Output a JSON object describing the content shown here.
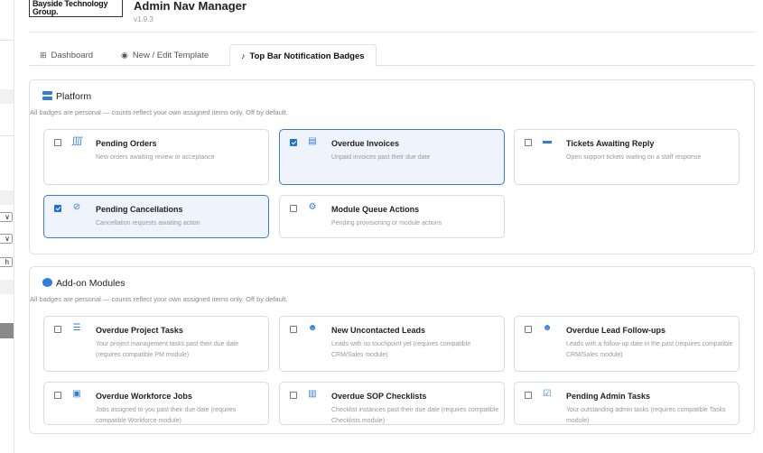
{
  "header": {
    "logo_line1": "Bayside Technology",
    "logo_line2": "Group.",
    "title": "Admin Nav Manager",
    "version": "v1.9.3"
  },
  "sidebar": {
    "select1_glyph": "∨",
    "select2_glyph": "∨",
    "button_glyph": "h"
  },
  "tabs": [
    {
      "label": "Dashboard",
      "icon": "grid-icon",
      "glyph": "⊞",
      "active": false
    },
    {
      "label": "New / Edit Template",
      "icon": "database-icon",
      "glyph": "◉",
      "active": false
    },
    {
      "label": "Top Bar Notification Badges",
      "icon": "bell-icon",
      "glyph": "♪",
      "active": true
    }
  ],
  "sections": [
    {
      "title": "Platform",
      "icon": "bars-icon",
      "description": "All badges are personal — counts reflect your own assigned items only. Off by default.",
      "cards": [
        {
          "title": "Pending Orders",
          "desc": "New orders awaiting review or acceptance",
          "icon": "cart-icon",
          "glyph": "⨌",
          "checked": false
        },
        {
          "title": "Overdue Invoices",
          "desc": "Unpaid invoices past their due date",
          "icon": "invoice-icon",
          "glyph": "▤",
          "checked": true
        },
        {
          "title": "Tickets Awaiting Reply",
          "desc": "Open support tickets waiting on a staff response",
          "icon": "ticket-icon",
          "glyph": "▬",
          "checked": false
        },
        {
          "title": "Pending Cancellations",
          "desc": "Cancellation requests awaiting action",
          "icon": "ban-icon",
          "glyph": "⊘",
          "checked": true
        },
        {
          "title": "Module Queue Actions",
          "desc": "Pending provisioning or module actions",
          "icon": "cogs-icon",
          "glyph": "⚙",
          "checked": false
        }
      ]
    },
    {
      "title": "Add-on Modules",
      "icon": "cube-icon",
      "description": "All badges are personal — counts reflect your own assigned items only. Off by default.",
      "cards": [
        {
          "title": "Overdue Project Tasks",
          "desc": "Your project management tasks past their due date (requires compatible PM module)",
          "icon": "task-list-icon",
          "glyph": "☰",
          "checked": false
        },
        {
          "title": "New Uncontacted Leads",
          "desc": "Leads with no touchpoint yet (requires compatible CRM/Sales module)",
          "icon": "user-plus-icon",
          "glyph": "☻",
          "checked": false
        },
        {
          "title": "Overdue Lead Follow-ups",
          "desc": "Leads with a follow-up date in the past (requires compatible CRM/Sales module)",
          "icon": "user-clock-icon",
          "glyph": "☻",
          "checked": false
        },
        {
          "title": "Overdue Workforce Jobs",
          "desc": "Jobs assigned to you past their due date (requires compatible Workforce module)",
          "icon": "briefcase-icon",
          "glyph": "▣",
          "checked": false
        },
        {
          "title": "Overdue SOP Checklists",
          "desc": "Checklist instances past their due date (requires compatible Checklists module)",
          "icon": "clipboard-icon",
          "glyph": "▥",
          "checked": false
        },
        {
          "title": "Pending Admin Tasks",
          "desc": "Your outstanding admin tasks (requires compatible Tasks module)",
          "icon": "check-square-icon",
          "glyph": "☑",
          "checked": false
        }
      ]
    }
  ]
}
